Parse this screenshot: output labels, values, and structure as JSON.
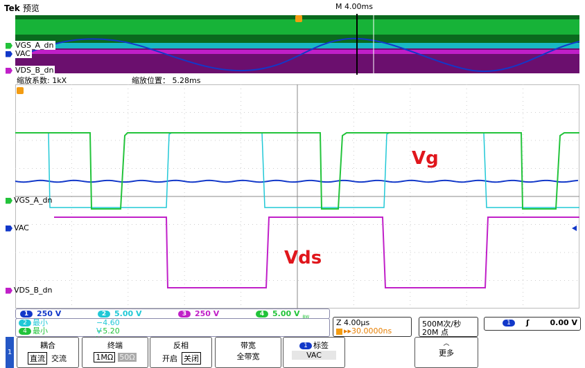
{
  "header": {
    "brand": "Tek",
    "mode": "预览",
    "timebase": "M 4.00ms"
  },
  "zoom_info": {
    "factor": "缩放系数: 1kX",
    "position": "缩放位置： 5.28ms"
  },
  "channels": {
    "vgs_a": {
      "label": "VGS_A_dn",
      "color": "#22c33a"
    },
    "vac": {
      "label": "VAC",
      "color": "#1238c9"
    },
    "vds_b": {
      "label": "VDS_B_dn",
      "color": "#c01fc8"
    },
    "ch2_color": "#20c8d6"
  },
  "annotations": {
    "vg": "Vg",
    "vds": "Vds"
  },
  "channel_bar": {
    "ch1": {
      "num": "1",
      "value": "250 V"
    },
    "ch2": {
      "num": "2",
      "value": "5.00 V"
    },
    "ch3": {
      "num": "3",
      "value": "250 V"
    },
    "ch4": {
      "num": "4",
      "value": "5.00 V"
    },
    "bw": "BW"
  },
  "measurements": [
    {
      "ch": "2",
      "name": "最小",
      "value": "−4.60 V"
    },
    {
      "ch": "4",
      "name": "最小",
      "value": "−5.20 V"
    }
  ],
  "zoom_box": {
    "timebase": "Z 4.00µs",
    "offset": "30.0000ns"
  },
  "rate_box": {
    "rate": "500M次/秒",
    "points": "20M 点"
  },
  "trigger_box": {
    "ch": "1",
    "slope": "ʃ",
    "level": "0.00 V"
  },
  "menu": {
    "tab": "1",
    "coupling": {
      "title": "耦合",
      "opt1": "直流",
      "opt2": "交流"
    },
    "termination": {
      "title": "终端",
      "opt1": "1MΩ",
      "opt2": "50Ω"
    },
    "invert": {
      "title": "反相",
      "opt1": "开启",
      "opt2": "关闭"
    },
    "bandwidth": {
      "title": "带宽",
      "value": "全带宽"
    },
    "label": {
      "ch": "1",
      "title": "标签",
      "value": "VAC"
    },
    "more": {
      "arrow": "︿",
      "title": "更多"
    }
  },
  "waveforms": {
    "ch4_high_volts": 5.0,
    "ch4_low_volts": -5.2,
    "ch2_low_volts": -4.6,
    "period_us": 25.2
  }
}
